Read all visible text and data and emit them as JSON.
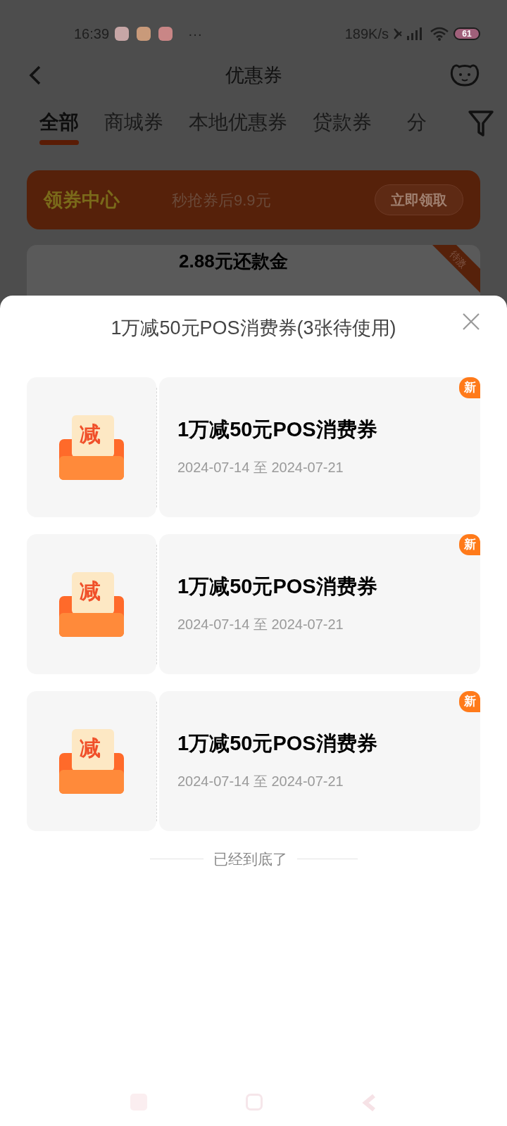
{
  "status_bar": {
    "time": "16:39",
    "more": "···",
    "speed": "189K/s",
    "battery": "61"
  },
  "header": {
    "title": "优惠券"
  },
  "tabs": [
    {
      "label": "全部",
      "selected": true
    },
    {
      "label": "商城券",
      "selected": false
    },
    {
      "label": "本地优惠券",
      "selected": false
    },
    {
      "label": "贷款券",
      "selected": false
    },
    {
      "label": "分",
      "selected": false
    }
  ],
  "banner": {
    "title": "领券中心",
    "text": "秒抢券后9.9元",
    "button": "立即领取"
  },
  "background_card": {
    "title": "2.88元还款金",
    "ribbon": "待激"
  },
  "sheet": {
    "title": "1万减50元POS消费券(3张待使用)",
    "coupons": [
      {
        "mark": "减",
        "name": "1万减50元POS消费券",
        "start": "2024-07-14",
        "to": "至",
        "end": "2024-07-21",
        "badge": "新"
      },
      {
        "mark": "减",
        "name": "1万减50元POS消费券",
        "start": "2024-07-14",
        "to": "至",
        "end": "2024-07-21",
        "badge": "新"
      },
      {
        "mark": "减",
        "name": "1万减50元POS消费券",
        "start": "2024-07-14",
        "to": "至",
        "end": "2024-07-21",
        "badge": "新"
      }
    ],
    "footer": "已经到底了"
  }
}
